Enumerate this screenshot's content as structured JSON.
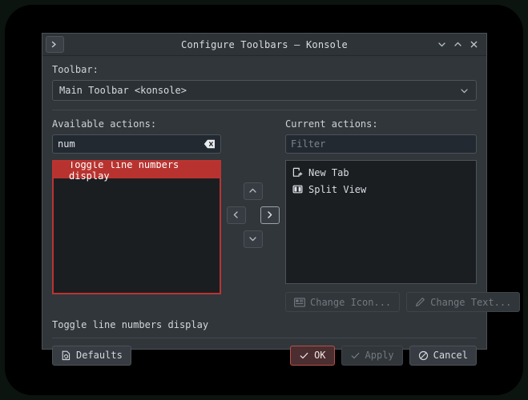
{
  "window": {
    "title": "Configure Toolbars — Konsole",
    "app_icon": "terminal-prompt-icon",
    "controls": {
      "minimize": "minimize-icon",
      "maximize": "maximize-icon",
      "close": "close-icon"
    }
  },
  "toolbar_section": {
    "label": "Toolbar:",
    "selected": "Main Toolbar <konsole>",
    "options": [
      "Main Toolbar <konsole>"
    ]
  },
  "available": {
    "label": "Available actions:",
    "search_value": "num",
    "search_placeholder": "",
    "clear_icon": "clear-text-icon",
    "items": [
      {
        "label": "Toggle line numbers display",
        "selected": true
      }
    ]
  },
  "transfer": {
    "up": "chevron-up-icon",
    "left": "chevron-left-icon",
    "right": "chevron-right-icon",
    "down": "chevron-down-icon"
  },
  "current": {
    "label": "Current actions:",
    "filter_placeholder": "Filter",
    "filter_value": "",
    "items": [
      {
        "label": "New Tab",
        "icon": "new-tab-icon"
      },
      {
        "label": "Split View",
        "icon": "split-view-icon"
      }
    ],
    "change_icon_button": "Change Icon...",
    "change_text_button": "Change Text..."
  },
  "status": {
    "text": "Toggle line numbers display"
  },
  "footer": {
    "defaults": "Defaults",
    "ok": "OK",
    "apply": "Apply",
    "cancel": "Cancel"
  },
  "colors": {
    "window_bg": "#31363b",
    "selection_red": "#b8332f",
    "focus_border_red": "#bb3431",
    "default_button_bg": "#4b2e2f",
    "list_bg": "#1b1e21",
    "text": "#d8dde1",
    "disabled_text": "#72797f"
  }
}
